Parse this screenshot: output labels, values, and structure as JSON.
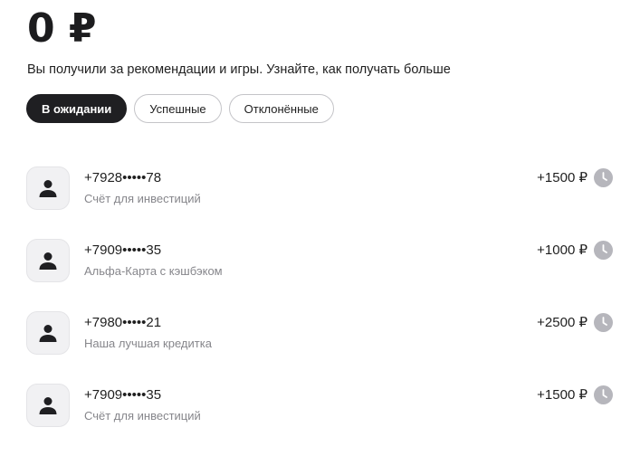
{
  "balance": "0 ₽",
  "subtitle": "Вы получили за рекомендации и игры. Узнайте, как получать больше",
  "tabs": [
    {
      "label": "В ожидании",
      "active": true
    },
    {
      "label": "Успешные",
      "active": false
    },
    {
      "label": "Отклонённые",
      "active": false
    }
  ],
  "items": [
    {
      "phone": "+7928•••••78",
      "product": "Счёт для инвестиций",
      "amount": "+1500 ₽",
      "status_icon": "clock-icon"
    },
    {
      "phone": "+7909•••••35",
      "product": "Альфа-Карта с кэшбэком",
      "amount": "+1000 ₽",
      "status_icon": "clock-icon"
    },
    {
      "phone": "+7980•••••21",
      "product": "Наша лучшая кредитка",
      "amount": "+2500 ₽",
      "status_icon": "clock-icon"
    },
    {
      "phone": "+7909•••••35",
      "product": "Счёт для инвестиций",
      "amount": "+1500 ₽",
      "status_icon": "clock-icon"
    }
  ],
  "colors": {
    "active_tab_bg": "#1f1f22",
    "secondary_text": "#86868b",
    "clock_icon": "#b6b6bc"
  }
}
